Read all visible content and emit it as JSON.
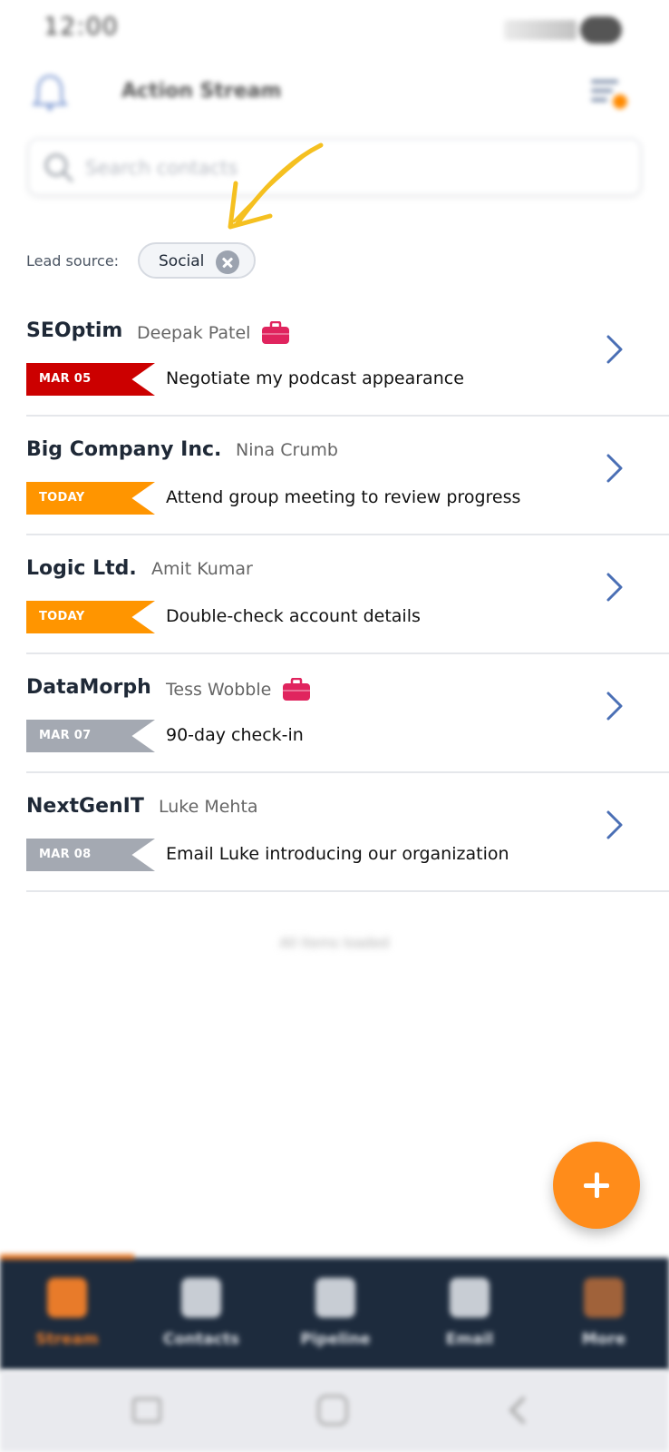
{
  "status_bar": {
    "time": "12:00"
  },
  "header": {
    "title": "Action Stream"
  },
  "search": {
    "placeholder": "Search contacts"
  },
  "filter": {
    "label": "Lead source:",
    "chip": "Social"
  },
  "colors": {
    "red": "#cc0000",
    "orange": "#ff9500",
    "gray": "#a4a9b2",
    "briefcase": "#e0245e",
    "accent": "#ff8c1a"
  },
  "items": [
    {
      "company": "SEOptim",
      "person": "Deepak Patel",
      "briefcase": true,
      "date": "MAR 05",
      "status": "overdue",
      "task": "Negotiate my podcast appearance"
    },
    {
      "company": "Big Company Inc.",
      "person": "Nina Crumb",
      "briefcase": false,
      "date": "TODAY",
      "status": "today",
      "task": "Attend group meeting to review progress"
    },
    {
      "company": "Logic Ltd.",
      "person": "Amit Kumar",
      "briefcase": false,
      "date": "TODAY",
      "status": "today",
      "task": "Double-check account details"
    },
    {
      "company": "DataMorph",
      "person": "Tess Wobble",
      "briefcase": true,
      "date": "MAR 07",
      "status": "upcoming",
      "task": "90-day check-in"
    },
    {
      "company": "NextGenIT",
      "person": "Luke Mehta",
      "briefcase": false,
      "date": "MAR 08",
      "status": "upcoming",
      "task": "Email Luke introducing our organization"
    }
  ],
  "footer_note": "All items loaded",
  "nav": {
    "items": [
      {
        "label": "Stream",
        "icon": "stream-icon"
      },
      {
        "label": "Contacts",
        "icon": "contacts-icon"
      },
      {
        "label": "Pipeline",
        "icon": "pipeline-icon"
      },
      {
        "label": "Email",
        "icon": "email-icon"
      },
      {
        "label": "More",
        "icon": "more-icon"
      }
    ]
  }
}
